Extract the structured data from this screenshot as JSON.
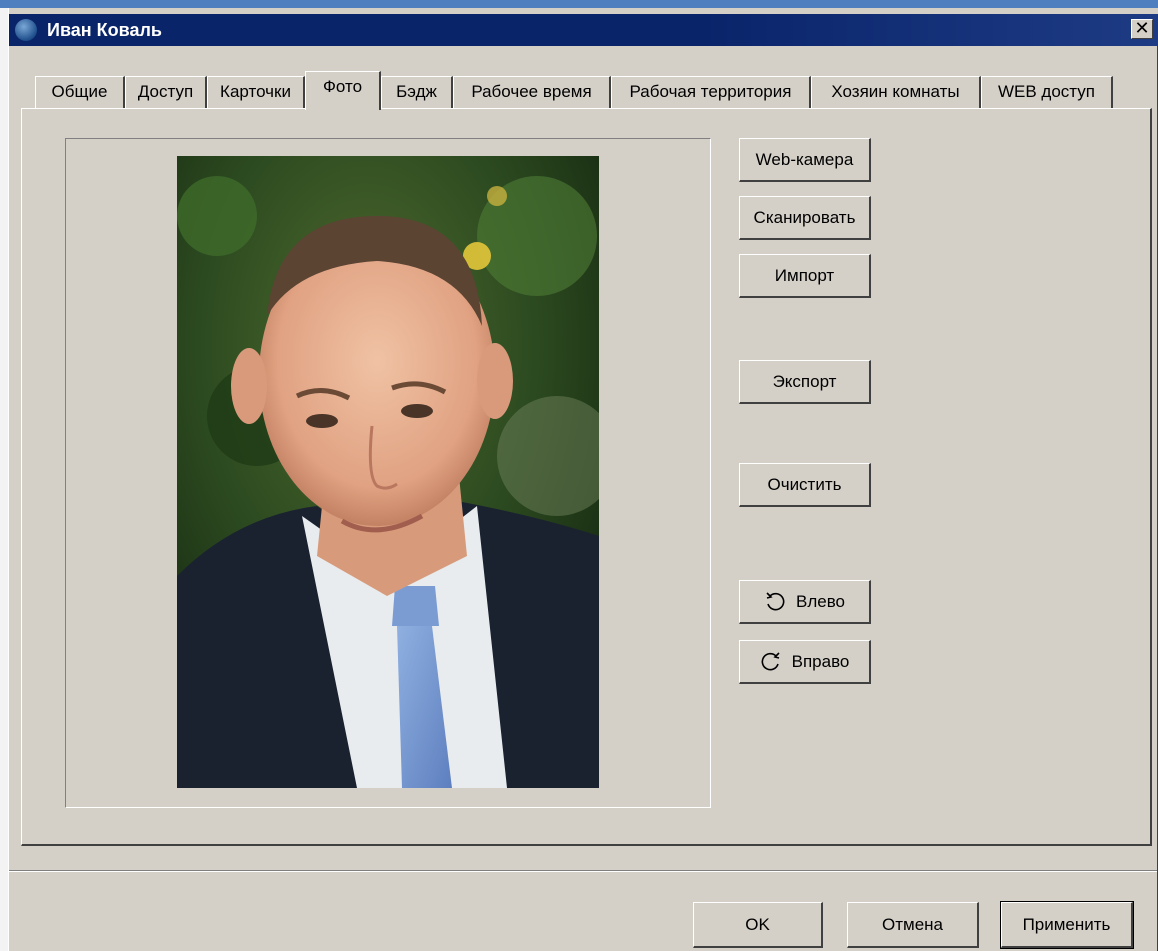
{
  "window": {
    "title": "Иван Коваль",
    "close_label": "✕"
  },
  "tabs": [
    {
      "label": "Общие"
    },
    {
      "label": "Доступ"
    },
    {
      "label": "Карточки"
    },
    {
      "label": "Фото",
      "active": true
    },
    {
      "label": "Бэдж"
    },
    {
      "label": "Рабочее время"
    },
    {
      "label": "Рабочая территория"
    },
    {
      "label": "Хозяин комнаты"
    },
    {
      "label": "WEB доступ"
    }
  ],
  "photo_panel": {
    "buttons": {
      "webcam": "Web-камера",
      "scan": "Сканировать",
      "import": "Импорт",
      "export": "Экспорт",
      "clear": "Очистить",
      "rotate_left": "Влево",
      "rotate_right": "Вправо"
    }
  },
  "footer": {
    "ok": "OK",
    "cancel": "Отмена",
    "apply": "Применить"
  },
  "icons": {
    "app": "app-globe-icon",
    "rotate_left": "rotate-left-icon",
    "rotate_right": "rotate-right-icon",
    "close": "close-icon"
  },
  "colors": {
    "titlebar": "#0a246a",
    "face": "#d4d0c8",
    "outer": "#4f7fbf"
  }
}
